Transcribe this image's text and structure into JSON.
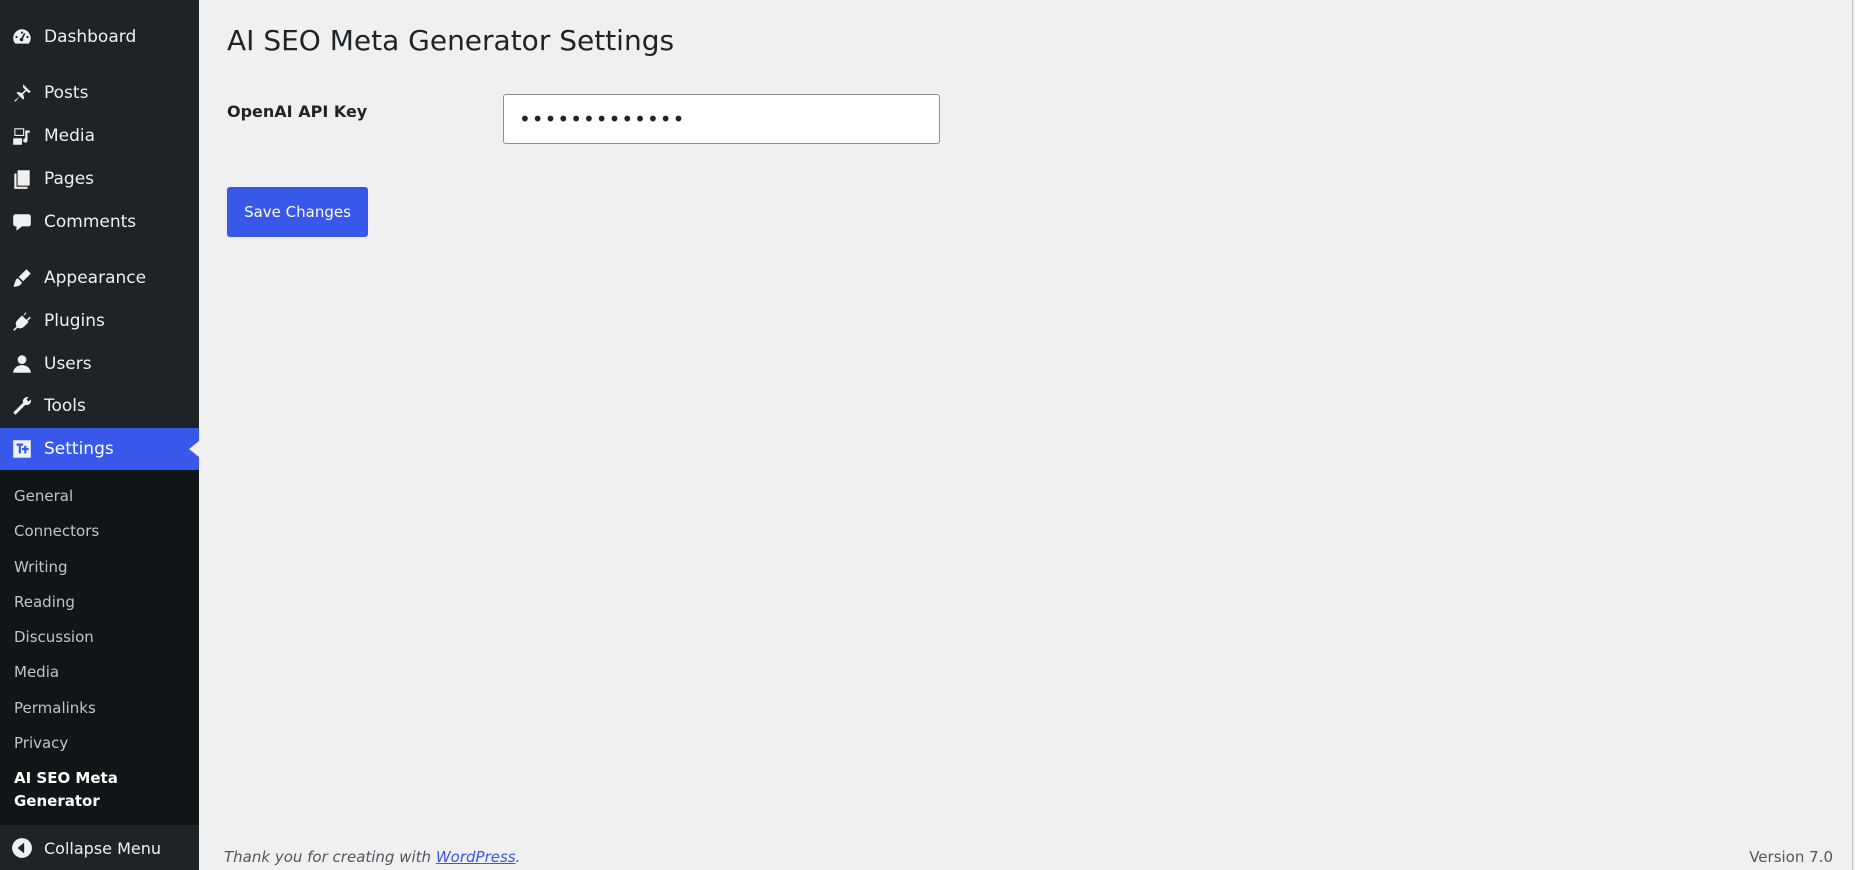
{
  "sidebar": {
    "items": [
      {
        "label": "Dashboard",
        "icon": "dashboard-icon"
      },
      {
        "label": "Posts",
        "icon": "pin-icon"
      },
      {
        "label": "Media",
        "icon": "media-icon"
      },
      {
        "label": "Pages",
        "icon": "pages-icon"
      },
      {
        "label": "Comments",
        "icon": "comment-icon"
      },
      {
        "label": "Appearance",
        "icon": "brush-icon"
      },
      {
        "label": "Plugins",
        "icon": "plug-icon"
      },
      {
        "label": "Users",
        "icon": "user-icon"
      },
      {
        "label": "Tools",
        "icon": "wrench-icon"
      },
      {
        "label": "Settings",
        "icon": "settings-icon"
      }
    ],
    "submenu": [
      "General",
      "Connectors",
      "Writing",
      "Reading",
      "Discussion",
      "Media",
      "Permalinks",
      "Privacy"
    ],
    "submenu_current": {
      "line1": "AI SEO Meta",
      "line2": "Generator"
    },
    "collapse_label": "Collapse Menu"
  },
  "main": {
    "title": "AI SEO Meta Generator Settings",
    "api_key_label": "OpenAI API Key",
    "api_key_value": "sk-xxxxxxxxxx",
    "save_label": "Save Changes"
  },
  "footer": {
    "thanks_prefix": "Thank you for creating with ",
    "thanks_link": "WordPress",
    "thanks_suffix": ".",
    "version": "Version 7.0"
  },
  "colors": {
    "accent": "#3858e9",
    "sidebar_bg": "#1d2327",
    "submenu_bg": "#101517",
    "page_bg": "#f0f0f1"
  }
}
